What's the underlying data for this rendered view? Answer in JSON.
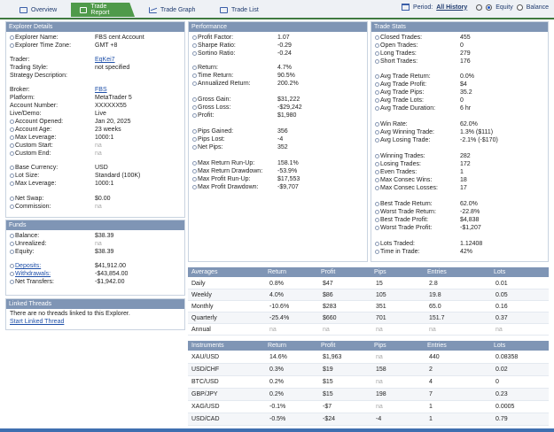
{
  "tabs": {
    "overview": "Overview",
    "trade_report": "Trade Report",
    "trade_graph": "Trade Graph",
    "trade_list": "Trade List"
  },
  "period": {
    "label": "Period:",
    "value": "All History",
    "equity": "Equity",
    "balance": "Balance"
  },
  "explorer_details": {
    "title": "Explorer Details",
    "rows": [
      {
        "label": "Explorer Name:",
        "value": "FBS cent Account"
      },
      {
        "label": "Explorer Time Zone:",
        "value": "GMT +8"
      },
      {
        "label": "Trader:",
        "value": "EqKei7"
      },
      {
        "label": "Trading Style:",
        "value": "not specified"
      },
      {
        "label": "Strategy Description:",
        "value": ""
      },
      {
        "label": "Broker:",
        "value": "FBS"
      },
      {
        "label": "Platform:",
        "value": "MetaTrader 5"
      },
      {
        "label": "Account Number:",
        "value": "XXXXXX55"
      },
      {
        "label": "Live/Demo:",
        "value": "Live"
      },
      {
        "label": "Account Opened:",
        "value": "Jan 20, 2025"
      },
      {
        "label": "Account Age:",
        "value": "23 weeks"
      },
      {
        "label": "Max Leverage:",
        "value": "1000:1"
      },
      {
        "label": "Custom Start:",
        "value": "na"
      },
      {
        "label": "Custom End:",
        "value": "na"
      },
      {
        "label": "Base Currency:",
        "value": "USD"
      },
      {
        "label": "Lot Size:",
        "value": "Standard (100K)"
      },
      {
        "label": "Max Leverage:",
        "value": "1000:1"
      },
      {
        "label": "Net Swap:",
        "value": "$0.00"
      },
      {
        "label": "Commission:",
        "value": "na"
      }
    ]
  },
  "funds": {
    "title": "Funds",
    "rows": [
      {
        "label": "Balance:",
        "value": "$38.39"
      },
      {
        "label": "Unrealized:",
        "value": "na"
      },
      {
        "label": "Equity:",
        "value": "$38.39"
      },
      {
        "label": "Deposits:",
        "value": "$41,912.00"
      },
      {
        "label": "Withdrawals:",
        "value": "-$43,854.00"
      },
      {
        "label": "Net Transfers:",
        "value": "-$1,942.00"
      }
    ]
  },
  "linked_threads": {
    "title": "Linked Threads",
    "message": "There are no threads linked to this Explorer.",
    "link": "Start Linked Thread"
  },
  "performance": {
    "title": "Performance",
    "rows": [
      {
        "label": "Profit Factor:",
        "value": "1.07"
      },
      {
        "label": "Sharpe Ratio:",
        "value": "-0.29"
      },
      {
        "label": "Sortino Ratio:",
        "value": "-0.24"
      },
      {
        "label": "Return:",
        "value": "4.7%"
      },
      {
        "label": "Time Return:",
        "value": "90.5%"
      },
      {
        "label": "Annualized Return:",
        "value": "200.2%"
      },
      {
        "label": "Gross Gain:",
        "value": "$31,222"
      },
      {
        "label": "Gross Loss:",
        "value": "-$29,242"
      },
      {
        "label": "Profit:",
        "value": "$1,980"
      },
      {
        "label": "Pips Gained:",
        "value": "356"
      },
      {
        "label": "Pips Lost:",
        "value": "-4"
      },
      {
        "label": "Net Pips:",
        "value": "352"
      },
      {
        "label": "Max Return Run-Up:",
        "value": "158.1%"
      },
      {
        "label": "Max Return Drawdown:",
        "value": "-53.9%"
      },
      {
        "label": "Max Profit Run-Up:",
        "value": "$17,553"
      },
      {
        "label": "Max Profit Drawdown:",
        "value": "-$9,707"
      }
    ]
  },
  "trade_stats": {
    "title": "Trade Stats",
    "rows": [
      {
        "label": "Closed Trades:",
        "value": "455"
      },
      {
        "label": "Open Trades:",
        "value": "0"
      },
      {
        "label": "Long Trades:",
        "value": "279"
      },
      {
        "label": "Short Trades:",
        "value": "176"
      },
      {
        "label": "Avg Trade Return:",
        "value": "0.0%"
      },
      {
        "label": "Avg Trade Profit:",
        "value": "$4"
      },
      {
        "label": "Avg Trade Pips:",
        "value": "35.2"
      },
      {
        "label": "Avg Trade Lots:",
        "value": "0"
      },
      {
        "label": "Avg Trade Duration:",
        "value": "6 hr"
      },
      {
        "label": "Win Rate:",
        "value": "62.0%"
      },
      {
        "label": "Avg Winning Trade:",
        "value": "1.3% ($111)"
      },
      {
        "label": "Avg Losing Trade:",
        "value": "-2.1% (-$170)"
      },
      {
        "label": "Winning Trades:",
        "value": "282"
      },
      {
        "label": "Losing Trades:",
        "value": "172"
      },
      {
        "label": "Even Trades:",
        "value": "1"
      },
      {
        "label": "Max Consec Wins:",
        "value": "18"
      },
      {
        "label": "Max Consec Losses:",
        "value": "17"
      },
      {
        "label": "Best Trade Return:",
        "value": "62.0%"
      },
      {
        "label": "Worst Trade Return:",
        "value": "-22.8%"
      },
      {
        "label": "Best Trade Profit:",
        "value": "$4,838"
      },
      {
        "label": "Worst Trade Profit:",
        "value": "-$1,207"
      },
      {
        "label": "Lots Traded:",
        "value": "1.12408"
      },
      {
        "label": "Time in Trade:",
        "value": "42%"
      }
    ]
  },
  "averages": {
    "headers": [
      "Averages",
      "Return",
      "Profit",
      "Pips",
      "Entries",
      "Lots"
    ],
    "rows": [
      [
        "Daily",
        "0.8%",
        "$47",
        "15",
        "2.8",
        "0.01"
      ],
      [
        "Weekly",
        "4.0%",
        "$86",
        "105",
        "19.8",
        "0.05"
      ],
      [
        "Monthly",
        "-10.6%",
        "$283",
        "351",
        "65.0",
        "0.16"
      ],
      [
        "Quarterly",
        "-25.4%",
        "$660",
        "701",
        "151.7",
        "0.37"
      ],
      [
        "Annual",
        "na",
        "na",
        "na",
        "na",
        "na"
      ]
    ]
  },
  "instruments": {
    "headers": [
      "Instruments",
      "Return",
      "Profit",
      "Pips",
      "Entries",
      "Lots"
    ],
    "rows": [
      [
        "XAU/USD",
        "14.6%",
        "$1,963",
        "na",
        "440",
        "0.08358"
      ],
      [
        "USD/CHF",
        "0.3%",
        "$19",
        "158",
        "2",
        "0.02"
      ],
      [
        "BTC/USD",
        "0.2%",
        "$15",
        "na",
        "4",
        "0"
      ],
      [
        "GBP/JPY",
        "0.2%",
        "$15",
        "198",
        "7",
        "0.23"
      ],
      [
        "XAG/USD",
        "-0.1%",
        "-$7",
        "na",
        "1",
        "0.0005"
      ],
      [
        "USD/CAD",
        "-0.5%",
        "-$24",
        "-4",
        "1",
        "0.79"
      ]
    ]
  },
  "colors": {
    "accent_green": "#4f9a4a",
    "panel_header": "#7f95b5",
    "link_blue": "#1e4fa8"
  }
}
